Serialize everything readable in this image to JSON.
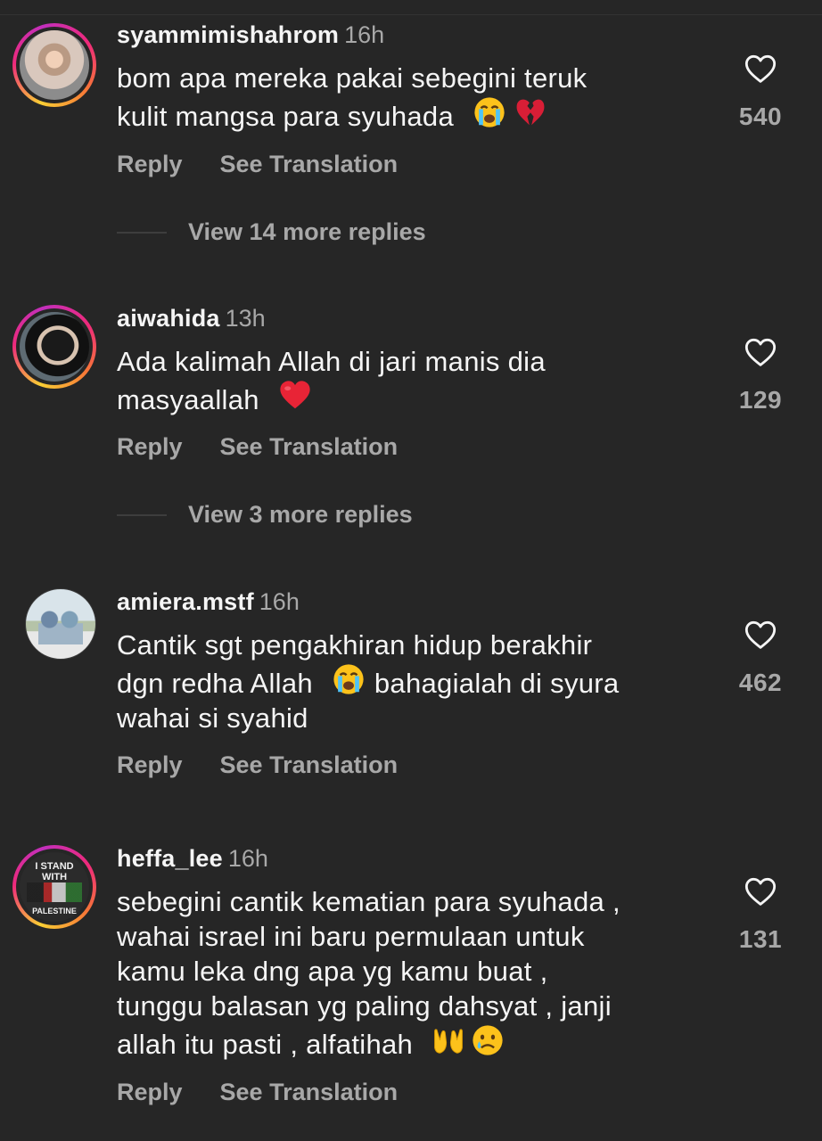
{
  "actions": {
    "reply": "Reply",
    "see_translation": "See Translation"
  },
  "comments": [
    {
      "username": "syammimishahrom",
      "time": "16h",
      "lines": [
        "bom apa mereka pakai sebegini teruk",
        "kulit mangsa para syuhada"
      ],
      "likes": "540",
      "view_more": "View 14 more replies"
    },
    {
      "username": "aiwahida",
      "time": "13h",
      "lines": [
        "Ada kalimah Allah di jari manis dia",
        "masyaallah"
      ],
      "likes": "129",
      "view_more": "View 3 more replies"
    },
    {
      "username": "amiera.mstf",
      "time": "16h",
      "lines": [
        "Cantik sgt pengakhiran hidup berakhir",
        "dgn redha Allah",
        "bahagialah di syura",
        "wahai si syahid"
      ],
      "likes": "462"
    },
    {
      "username": "heffa_lee",
      "time": "16h",
      "lines": [
        "sebegini cantik kematian para syuhada ,",
        "wahai israel ini baru permulaan untuk",
        "kamu leka dng apa yg kamu buat ,",
        "tunggu balasan yg paling dahsyat , janji",
        "allah itu pasti , alfatihah"
      ],
      "likes": "131",
      "avatar_text": [
        "I STAND",
        "WITH",
        "PALESTINE"
      ]
    }
  ],
  "icons": {
    "like": "heart-outline-icon",
    "emoji_crying": "loudly-crying-face-emoji",
    "emoji_broken_heart": "broken-heart-emoji",
    "emoji_red_heart": "red-heart-emoji",
    "emoji_raised_hands": "palms-up-together-emoji",
    "emoji_sad": "crying-face-emoji"
  },
  "colors": {
    "background": "#262626",
    "primary_text": "#f5f5f5",
    "secondary_text": "#a8a8a8",
    "divider": "#3d3d3d"
  }
}
